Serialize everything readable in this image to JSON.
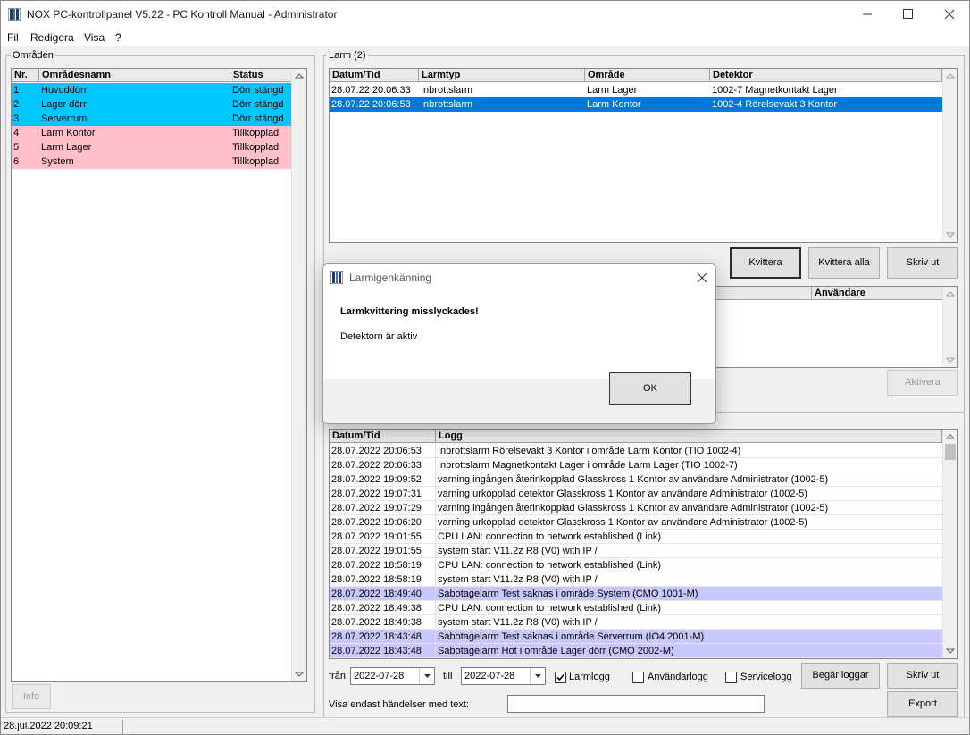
{
  "window": {
    "title": "NOX PC-kontrollpanel V5.22 - PC Kontroll Manual - Administrator"
  },
  "menu": [
    "Fil",
    "Redigera",
    "Visa",
    "?"
  ],
  "areas": {
    "label": "Områden",
    "columns": [
      "Nr.",
      "Områdesnamn",
      "Status"
    ],
    "rows": [
      {
        "nr": "1",
        "name": "Huvuddörr",
        "status": "Dörr stängd",
        "color": "#00c8ff"
      },
      {
        "nr": "2",
        "name": "Lager dörr",
        "status": "Dörr stängd",
        "color": "#00c8ff"
      },
      {
        "nr": "3",
        "name": "Serverrum",
        "status": "Dörr stängd",
        "color": "#00c8ff"
      },
      {
        "nr": "4",
        "name": "Larm Kontor",
        "status": "Tillkopplad",
        "color": "#ffc0c8"
      },
      {
        "nr": "5",
        "name": "Larm Lager",
        "status": "Tillkopplad",
        "color": "#ffc0c8"
      },
      {
        "nr": "6",
        "name": "System",
        "status": "Tillkopplad",
        "color": "#ffc0c8"
      }
    ],
    "info_button": "Info"
  },
  "alarms": {
    "label": "Larm (2)",
    "columns": [
      "Datum/Tid",
      "Larmtyp",
      "Område",
      "Detektor"
    ],
    "rows": [
      {
        "time": "28.07.22 20:06:33",
        "type": "Inbrottslarm",
        "area": "Larm Lager",
        "detector": "1002-7 Magnetkontakt Lager",
        "selected": false
      },
      {
        "time": "28.07.22 20:06:53",
        "type": "Inbrottslarm",
        "area": "Larm Kontor",
        "detector": "1002-4 Rörelsevakt 3 Kontor",
        "selected": true
      }
    ],
    "buttons": {
      "ack": "Kvittera",
      "ack_all": "Kvittera alla",
      "print": "Skriv ut"
    }
  },
  "second_list": {
    "columns": [
      "Användare"
    ],
    "activate_button": "Aktivera"
  },
  "log": {
    "columns": [
      "Datum/Tid",
      "Logg"
    ],
    "rows": [
      {
        "time": "28.07.2022 20:06:53",
        "text": "Inbrottslarm Rörelsevakt 3 Kontor i område Larm Kontor (TIO 1002-4)",
        "hl": false
      },
      {
        "time": "28.07.2022 20:06:33",
        "text": "Inbrottslarm Magnetkontakt Lager i område Larm Lager (TIO 1002-7)",
        "hl": false
      },
      {
        "time": "28.07.2022 19:09:52",
        "text": "varning ingången återinkopplad Glasskross 1 Kontor av användare Administrator (1002-5)",
        "hl": false
      },
      {
        "time": "28.07.2022 19:07:31",
        "text": "varning urkopplad detektor Glasskross 1 Kontor av användare Administrator (1002-5)",
        "hl": false
      },
      {
        "time": "28.07.2022 19:07:29",
        "text": "varning ingången återinkopplad Glasskross 1 Kontor av användare Administrator (1002-5)",
        "hl": false
      },
      {
        "time": "28.07.2022 19:06:20",
        "text": "varning urkopplad detektor Glasskross 1 Kontor av användare Administrator (1002-5)",
        "hl": false
      },
      {
        "time": "28.07.2022 19:01:55",
        "text": "CPU LAN: connection to network established (Link)",
        "hl": false
      },
      {
        "time": "28.07.2022 19:01:55",
        "text": "system start V11.2z R8 (V0) with IP  /",
        "hl": false
      },
      {
        "time": "28.07.2022 18:58:19",
        "text": "CPU LAN: connection to network established (Link)",
        "hl": false
      },
      {
        "time": "28.07.2022 18:58:19",
        "text": "system start V11.2z R8 (V0) with IP  /",
        "hl": false
      },
      {
        "time": "28.07.2022 18:49:40",
        "text": "Sabotagelarm Test  saknas i område System (CMO 1001-M)",
        "hl": true
      },
      {
        "time": "28.07.2022 18:49:38",
        "text": "CPU LAN: connection to network established (Link)",
        "hl": false
      },
      {
        "time": "28.07.2022 18:49:38",
        "text": "system start V11.2z R8 (V0) with IP  /",
        "hl": false
      },
      {
        "time": "28.07.2022 18:43:48",
        "text": "Sabotagelarm Test  saknas i område Serverrum (IO4 2001-M)",
        "hl": true
      },
      {
        "time": "28.07.2022 18:43:48",
        "text": "Sabotagelarm Hot i område Lager dörr (CMO 2002-M)",
        "hl": true
      }
    ],
    "filter": {
      "from_label": "från",
      "from_value": "2022-07-28",
      "to_label": "till",
      "to_value": "2022-07-28",
      "alarm_log": "Larmlogg",
      "user_log": "Användarlogg",
      "service_log": "Servicelogg",
      "request_button": "Begär loggar",
      "print_button": "Skriv ut",
      "text_label": "Visa endast händelser med text:",
      "text_value": "",
      "export_button": "Export"
    }
  },
  "status": {
    "datetime": "28.jul.2022  20:09:21"
  },
  "dialog": {
    "title": "Larmigenkänning",
    "heading": "Larmkvittering misslyckades!",
    "message": "Detektorn är aktiv",
    "ok": "OK"
  },
  "colors": {
    "selected_row": "#0078d7",
    "highlight_row": "#c8c8ff"
  }
}
